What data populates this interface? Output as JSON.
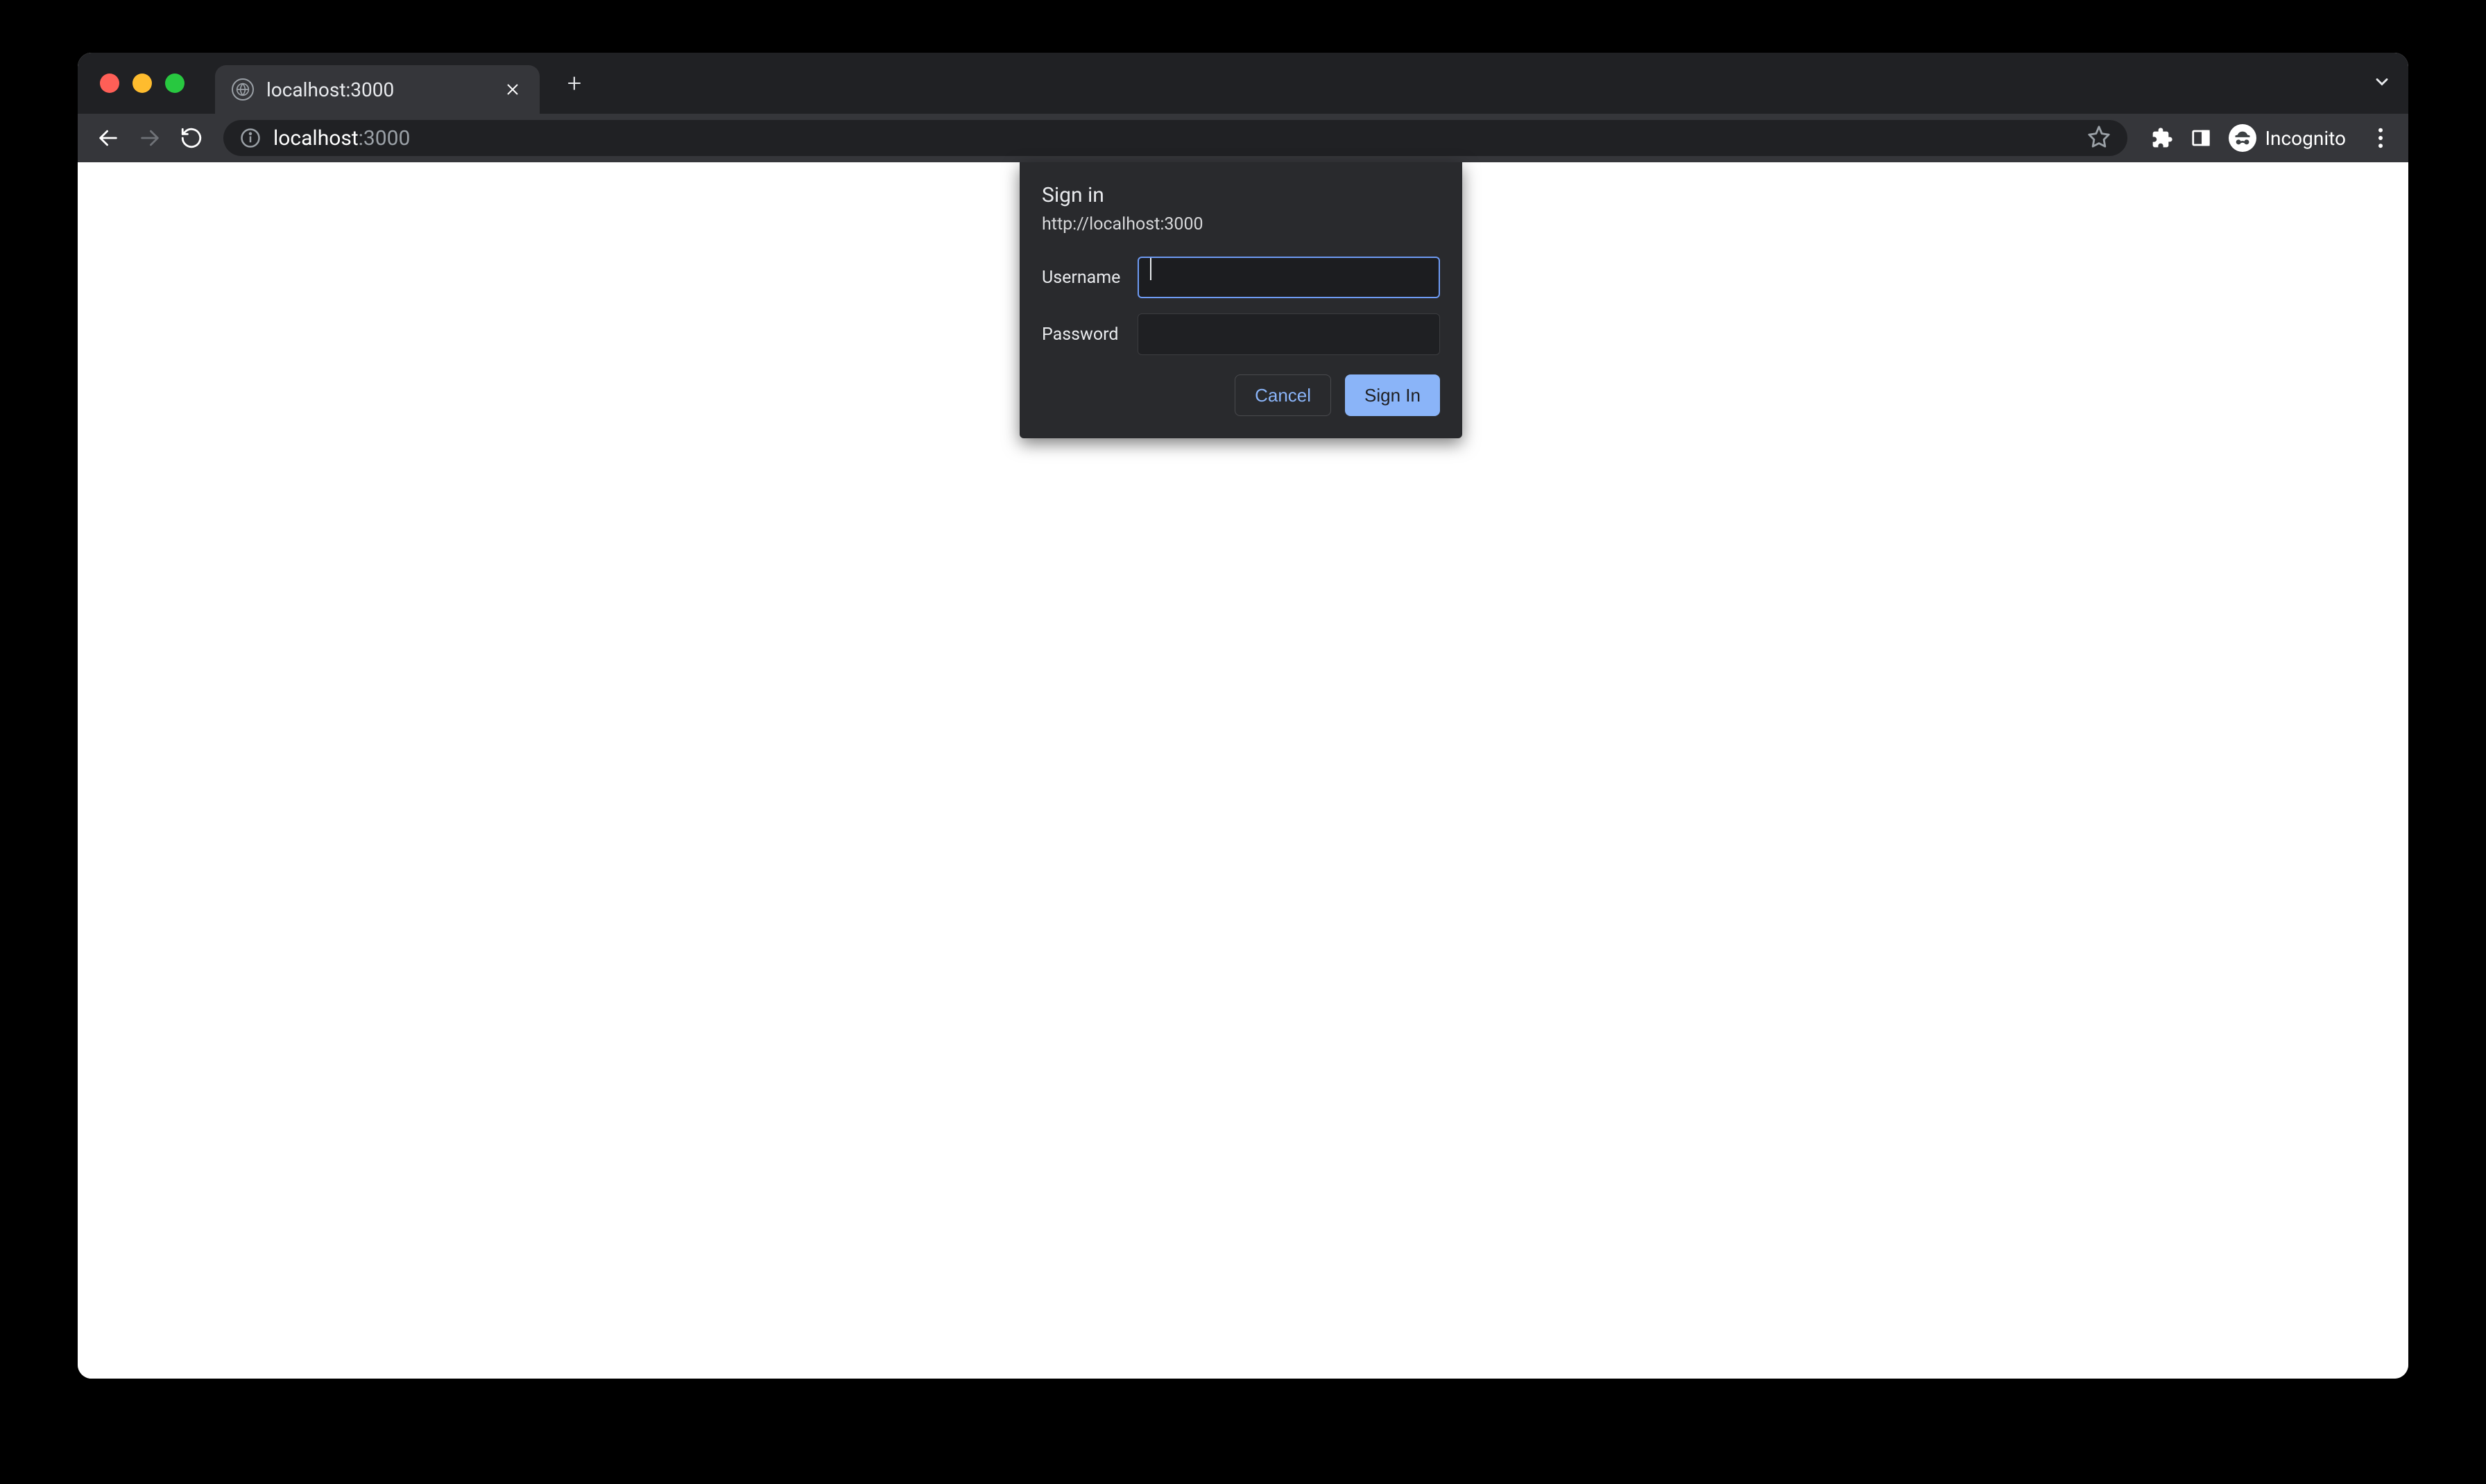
{
  "tab": {
    "title": "localhost:3000"
  },
  "address": {
    "host": "localhost",
    "port_suffix": ":3000"
  },
  "profile": {
    "label": "Incognito"
  },
  "dialog": {
    "title": "Sign in",
    "origin": "http://localhost:3000",
    "username_label": "Username",
    "password_label": "Password",
    "username_value": "",
    "password_value": "",
    "cancel_label": "Cancel",
    "signin_label": "Sign In"
  }
}
